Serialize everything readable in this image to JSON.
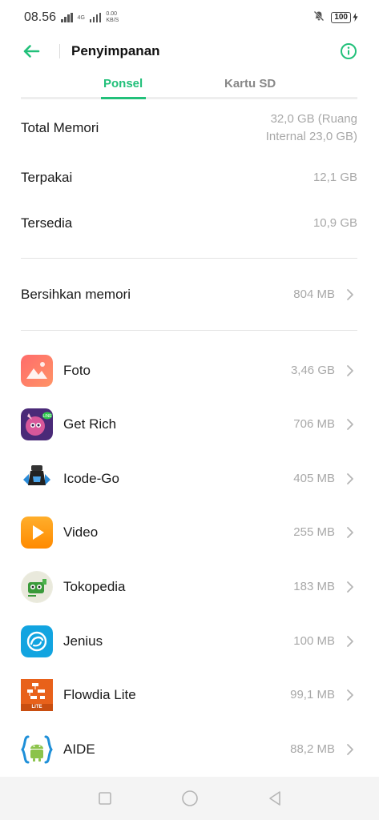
{
  "status_bar": {
    "time": "08.56",
    "network": "4G",
    "speed_value": "0.00",
    "speed_unit": "KB/S",
    "battery": "100"
  },
  "header": {
    "title": "Penyimpanan"
  },
  "tabs": [
    {
      "label": "Ponsel",
      "active": true
    },
    {
      "label": "Kartu SD",
      "active": false
    }
  ],
  "storage": {
    "total": {
      "label": "Total Memori",
      "value_line1": "32,0 GB (Ruang",
      "value_line2": "Internal 23,0 GB)"
    },
    "used": {
      "label": "Terpakai",
      "value": "12,1 GB"
    },
    "free": {
      "label": "Tersedia",
      "value": "10,9 GB"
    }
  },
  "clean": {
    "label": "Bersihkan memori",
    "value": "804 MB"
  },
  "apps": [
    {
      "name": "Foto",
      "size": "3,46 GB",
      "icon": "photos-icon"
    },
    {
      "name": "Get Rich",
      "size": "706 MB",
      "icon": "get-rich-icon"
    },
    {
      "name": "Icode-Go",
      "size": "405 MB",
      "icon": "icode-go-icon"
    },
    {
      "name": "Video",
      "size": "255 MB",
      "icon": "video-icon"
    },
    {
      "name": "Tokopedia",
      "size": "183 MB",
      "icon": "tokopedia-icon"
    },
    {
      "name": "Jenius",
      "size": "100 MB",
      "icon": "jenius-icon"
    },
    {
      "name": "Flowdia Lite",
      "size": "99,1 MB",
      "icon": "flowdia-lite-icon",
      "badge": "LITE"
    },
    {
      "name": "AIDE",
      "size": "88,2 MB",
      "icon": "aide-icon"
    }
  ],
  "colors": {
    "accent": "#22c07a",
    "secondary_text": "#a8a8a8"
  }
}
